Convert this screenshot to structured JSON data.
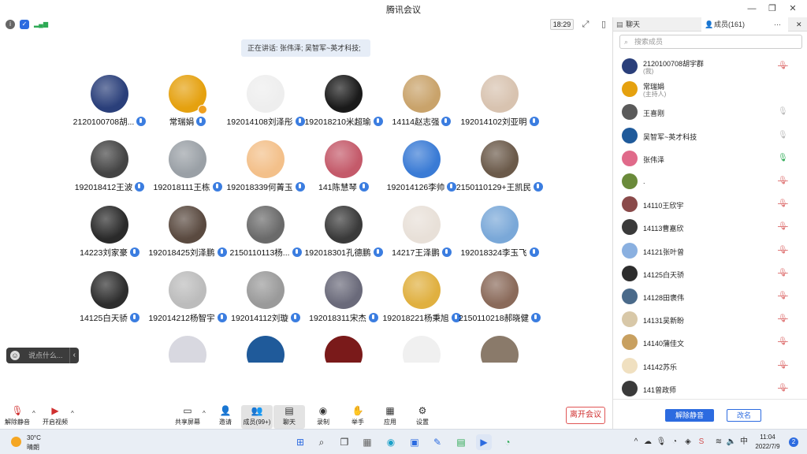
{
  "window": {
    "title": "腾讯会议",
    "minimize": "—",
    "restore": "❐",
    "close": "✕"
  },
  "toolbar": {
    "clock": "18:29"
  },
  "speaking": {
    "text": "正在讲话: 张伟泽; 吴智军~英才科技;"
  },
  "grid": {
    "rows": [
      [
        {
          "name": "2120100708胡...",
          "color": "#2a3f7a"
        },
        {
          "name": "常瑞娟",
          "color": "#e5a10f"
        },
        {
          "name": "192014108刘泽彤",
          "color": "#eeeeee"
        },
        {
          "name": "192018210米超瑜",
          "color": "#1a1a1a"
        },
        {
          "name": "14114赵志强",
          "color": "#c9a36b"
        },
        {
          "name": "192014102刘亚明",
          "color": "#d8c3b0"
        }
      ],
      [
        {
          "name": "192018412王波",
          "color": "#444444"
        },
        {
          "name": "192018111王栋",
          "color": "#9aa0a6"
        },
        {
          "name": "192018339何菁玉",
          "color": "#f3c08a"
        },
        {
          "name": "141陈慧琴",
          "color": "#c45a6a"
        },
        {
          "name": "192014126李帅",
          "color": "#3a7bd5"
        },
        {
          "name": "2150110129+王凯民",
          "color": "#6b5a4a"
        }
      ],
      [
        {
          "name": "14223刘家豪",
          "color": "#2a2a2a"
        },
        {
          "name": "192018425刘泽鹏",
          "color": "#5a4a40"
        },
        {
          "name": "2150110113杨...",
          "color": "#6a6a6a"
        },
        {
          "name": "192018301孔德鹏",
          "color": "#3a3a3a"
        },
        {
          "name": "14217王泽鹏",
          "color": "#e8e0d8"
        },
        {
          "name": "192018324李玉飞",
          "color": "#7aa8d8"
        }
      ],
      [
        {
          "name": "14125白天骄",
          "color": "#2d2d2d"
        },
        {
          "name": "192014212杨智宇",
          "color": "#bcbcbc"
        },
        {
          "name": "192014112刘璇",
          "color": "#9a9a9a"
        },
        {
          "name": "192018311宋杰",
          "color": "#6a6a7a"
        },
        {
          "name": "192018221杨秉旭",
          "color": "#e0b040"
        },
        {
          "name": "2150110218郝晓健",
          "color": "#8a6a5a"
        }
      ]
    ],
    "partial": [
      {
        "color": "#d8d8e0"
      },
      {
        "color": "#1f5a9a"
      },
      {
        "color": "#7a1a1a"
      },
      {
        "color": "#f0f0f0"
      },
      {
        "color": "#8a7a6a"
      }
    ]
  },
  "quickchat": {
    "placeholder": "说点什么...",
    "arrow": "‹"
  },
  "bottombar": {
    "unmute": "解除静音",
    "video": "开启视频",
    "share": "共享屏幕",
    "invite": "邀请",
    "members": "成员(99+)",
    "chat": "聊天",
    "record": "录制",
    "raise": "举手",
    "apps": "应用",
    "settings": "设置",
    "leave": "离开会议"
  },
  "panel": {
    "tab_chat": "聊天",
    "tab_members": "成员(161)",
    "more": "···",
    "search_placeholder": "搜索成员",
    "members": [
      {
        "name": "2120100708胡宇群",
        "role": "(我)",
        "mic": "muted",
        "color": "#2a3f7a"
      },
      {
        "name": "常瑞娟",
        "role": "(主持人)",
        "mic": "none",
        "color": "#e5a10f"
      },
      {
        "name": "王喜刚",
        "role": "",
        "mic": "idle",
        "color": "#5a5a5a"
      },
      {
        "name": "吴智军~英才科技",
        "role": "",
        "mic": "idle",
        "color": "#1f5a9a"
      },
      {
        "name": "张伟泽",
        "role": "",
        "mic": "live",
        "color": "#e06a8a"
      },
      {
        "name": ".",
        "role": "",
        "mic": "muted",
        "color": "#6a8a3a"
      },
      {
        "name": "14110王欣宇",
        "role": "",
        "mic": "muted",
        "color": "#8a4a4a"
      },
      {
        "name": "14113曹嘉欣",
        "role": "",
        "mic": "muted",
        "color": "#3a3a3a"
      },
      {
        "name": "14121张叶曾",
        "role": "",
        "mic": "muted",
        "color": "#8ab0e0"
      },
      {
        "name": "14125白天骄",
        "role": "",
        "mic": "muted",
        "color": "#2d2d2d"
      },
      {
        "name": "14128田褒伟",
        "role": "",
        "mic": "muted",
        "color": "#4a6a8a"
      },
      {
        "name": "14131吴新盼",
        "role": "",
        "mic": "muted",
        "color": "#d8c8a8"
      },
      {
        "name": "14140蒲佳文",
        "role": "",
        "mic": "muted",
        "color": "#c8a060"
      },
      {
        "name": "14142苏乐",
        "role": "",
        "mic": "muted",
        "color": "#f0e0c0"
      },
      {
        "name": "141曾政师",
        "role": "",
        "mic": "muted",
        "color": "#3a3a3a"
      }
    ],
    "unmute_all": "解除静音",
    "rename": "改名"
  },
  "taskbar": {
    "temp": "30°C",
    "weather": "晴朗",
    "time": "11:04",
    "date": "2022/7/9",
    "notifications": "2",
    "lang": "中"
  }
}
